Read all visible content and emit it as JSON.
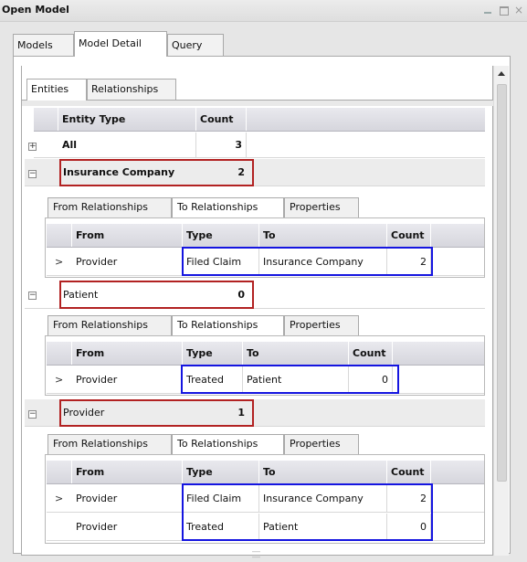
{
  "window": {
    "title": "Open Model"
  },
  "outer_tabs": [
    "Models",
    "Model Detail",
    "Query"
  ],
  "inner_tabs": [
    "Entities",
    "Relationships"
  ],
  "entity_grid": {
    "headers": [
      "Entity Type",
      "Count"
    ],
    "all_row": {
      "label": "All",
      "count": "3"
    }
  },
  "groups": [
    {
      "entity": "Insurance Company",
      "count": "2",
      "tabs": [
        "From Relationships",
        "To Relationships",
        "Properties"
      ],
      "headers": [
        "From",
        "Type",
        "To",
        "Count"
      ],
      "rows": [
        {
          "from": "Provider",
          "type": "Filed Claim",
          "to": "Insurance Company",
          "count": "2"
        }
      ]
    },
    {
      "entity": "Patient",
      "count": "0",
      "tabs": [
        "From Relationships",
        "To Relationships",
        "Properties"
      ],
      "headers": [
        "From",
        "Type",
        "To",
        "Count"
      ],
      "rows": [
        {
          "from": "Provider",
          "type": "Treated",
          "to": "Patient",
          "count": "0"
        }
      ]
    },
    {
      "entity": "Provider",
      "count": "1",
      "tabs": [
        "From Relationships",
        "To Relationships",
        "Properties"
      ],
      "headers": [
        "From",
        "Type",
        "To",
        "Count"
      ],
      "rows": [
        {
          "from": "Provider",
          "type": "Filed Claim",
          "to": "Insurance Company",
          "count": "2"
        },
        {
          "from": "Provider",
          "type": "Treated",
          "to": "Patient",
          "count": "0"
        }
      ]
    }
  ],
  "icons": {
    "expand": "+",
    "collapse": "−",
    "row_selector": ">"
  },
  "colors": {
    "red_highlight": "#b22222",
    "blue_highlight": "#1515e0"
  }
}
